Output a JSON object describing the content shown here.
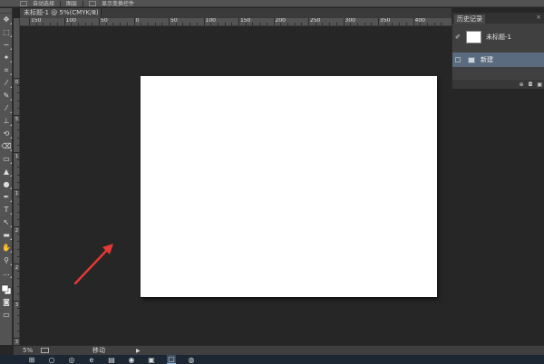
{
  "options_bar": {
    "auto_select_label": "自动选择",
    "layer_select_label": "图层",
    "transform_label": "显示变换控件"
  },
  "document_tab": {
    "title": "未标题-1 @ 5%(CMYK/8)",
    "close": "×"
  },
  "rulers": {
    "top_labels": [
      "150",
      "100",
      "50",
      "0",
      "50",
      "100",
      "150",
      "200",
      "250",
      "300",
      "350",
      "400"
    ],
    "left_labels": [
      "0",
      "5",
      "1",
      "1",
      "2",
      "2",
      "3",
      "3"
    ]
  },
  "toolbar": {
    "tools": [
      {
        "name": "move-tool-icon",
        "glyph": "✥"
      },
      {
        "name": "marquee-tool-icon",
        "glyph": "⬚"
      },
      {
        "name": "lasso-tool-icon",
        "glyph": "∽"
      },
      {
        "name": "magic-wand-tool-icon",
        "glyph": "✦"
      },
      {
        "name": "crop-tool-icon",
        "glyph": "⌗"
      },
      {
        "name": "eyedropper-tool-icon",
        "glyph": "⁄"
      },
      {
        "name": "healing-brush-tool-icon",
        "glyph": "✎"
      },
      {
        "name": "brush-tool-icon",
        "glyph": "⁄"
      },
      {
        "name": "clone-stamp-tool-icon",
        "glyph": "⊥"
      },
      {
        "name": "history-brush-tool-icon",
        "glyph": "⟲"
      },
      {
        "name": "eraser-tool-icon",
        "glyph": "⌫"
      },
      {
        "name": "gradient-tool-icon",
        "glyph": "▭"
      },
      {
        "name": "blur-tool-icon",
        "glyph": "▲"
      },
      {
        "name": "dodge-tool-icon",
        "glyph": "●"
      },
      {
        "name": "pen-tool-icon",
        "glyph": "✒"
      },
      {
        "name": "type-tool-icon",
        "glyph": "T"
      },
      {
        "name": "path-selection-tool-icon",
        "glyph": "↖"
      },
      {
        "name": "shape-tool-icon",
        "glyph": "▬"
      },
      {
        "name": "hand-tool-icon",
        "glyph": "✋"
      },
      {
        "name": "zoom-tool-icon",
        "glyph": "⚲"
      },
      {
        "name": "more-tools-icon",
        "glyph": "…"
      }
    ],
    "quick_mask_glyph": "◙",
    "screen_mode_glyph": "▭"
  },
  "history_panel": {
    "tab_label": "历史记录",
    "close": "×",
    "snapshot_icon": "✐",
    "snapshot_label": "未标题-1",
    "state_label": "新建",
    "footer_icons": [
      "⊕",
      "◘",
      "▣"
    ]
  },
  "status_bar": {
    "zoom": "5%",
    "info": "移动",
    "menu_arrow": "▶"
  },
  "taskbar": {
    "items": [
      {
        "name": "start-icon",
        "glyph": "⊞"
      },
      {
        "name": "search-icon",
        "glyph": "○"
      },
      {
        "name": "task-view-icon",
        "glyph": "◎"
      },
      {
        "name": "edge-icon",
        "glyph": "e"
      },
      {
        "name": "file-explorer-icon",
        "glyph": "▤"
      },
      {
        "name": "browser-icon",
        "glyph": "◉"
      },
      {
        "name": "store-icon",
        "glyph": "▣"
      },
      {
        "name": "photoshop-taskbar-icon",
        "glyph": "▢",
        "active": true
      },
      {
        "name": "chrome-icon",
        "glyph": "◍"
      }
    ]
  },
  "colors": {
    "accent_arrow": "#e53935",
    "selected_state": "#5a6b80",
    "canvas_bg": "#262626"
  }
}
